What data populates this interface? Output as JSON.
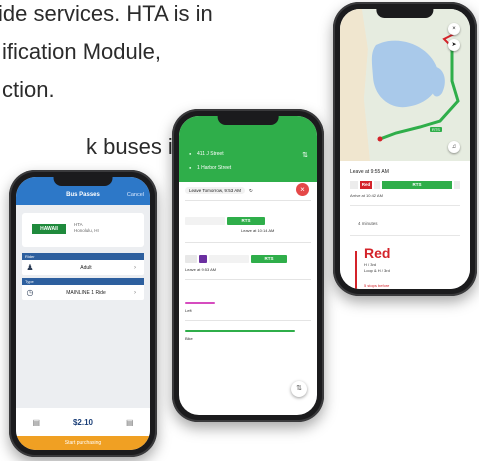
{
  "slide": {
    "line1": "ide services. HTA is in",
    "line2": "ification Module,",
    "line3": "ction.",
    "line4": "k buses in"
  },
  "phone1": {
    "title": "Bus Passes",
    "cancel": "Cancel",
    "agency_logo": "HAWAII",
    "agency_line1": "HTA",
    "agency_line2": "Honolulu, HI",
    "rider_section": "Rider",
    "rider_value": "Adult",
    "type_section": "Type",
    "type_value": "MAINLINE 1 Ride",
    "price": "$2.10",
    "cta": "Start purchasing"
  },
  "phone2": {
    "from_field": "411 J Street",
    "to_field": "1 Harbor Street",
    "leave_label": "Leave Tomorrow, 9:53 AM",
    "route_label": "RTS",
    "leave_at_1": "Leave at 10:14 AM",
    "route_label_2": "RTS",
    "leave_at_2": "Leave at 9:53 AM",
    "walk_left": "Left",
    "bike_label": "Bike"
  },
  "phone3": {
    "leave_label": "Leave at 9:55 AM",
    "route_red": "Red",
    "route_rts": "RTS",
    "arrive_label": "Arrive at 10:42 AM",
    "walk_label": "4 minutes",
    "line_name": "Red",
    "stop_name": "H / 3rd",
    "stop_sub": "Loop & H / 3rd",
    "stop_more": "5 stops before",
    "map_label": "RTS"
  },
  "colors": {
    "hta_blue": "#2d78c8",
    "rts_green": "#2fae4a",
    "red_line": "#d4232a",
    "cta_orange": "#f0a023"
  }
}
